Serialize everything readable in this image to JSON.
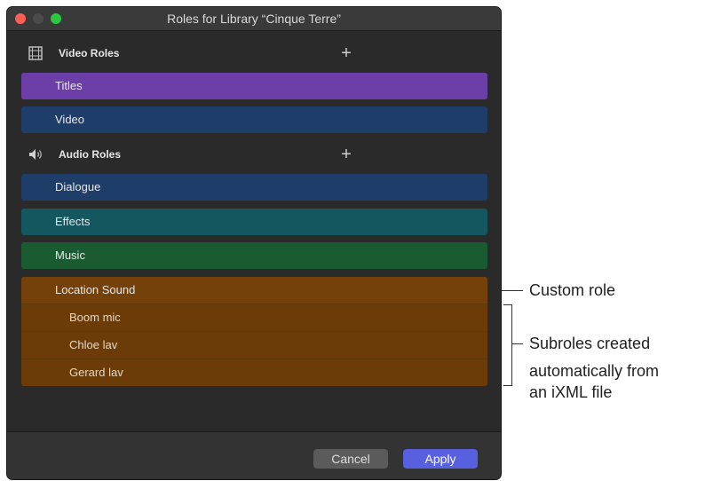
{
  "window": {
    "title": "Roles for Library “Cinque Terre”"
  },
  "video_section": {
    "label": "Video Roles",
    "add_symbol": "+",
    "icon": "film-icon"
  },
  "video_roles": [
    {
      "label": "Titles",
      "color": "#6c3fa8"
    },
    {
      "label": "Video",
      "color": "#1f3d69"
    }
  ],
  "audio_section": {
    "label": "Audio Roles",
    "add_symbol": "+",
    "icon": "speaker-icon"
  },
  "audio_roles": [
    {
      "label": "Dialogue",
      "color": "#1f3d69"
    },
    {
      "label": "Effects",
      "color": "#15575f"
    },
    {
      "label": "Music",
      "color": "#1a5b31"
    },
    {
      "label": "Location Sound",
      "color": "#74410a"
    }
  ],
  "subroles": [
    {
      "label": "Boom mic",
      "color": "#6b3c08"
    },
    {
      "label": "Chloe lav",
      "color": "#6b3c08"
    },
    {
      "label": "Gerard lav",
      "color": "#6b3c08"
    }
  ],
  "footer": {
    "cancel_label": "Cancel",
    "apply_label": "Apply"
  },
  "callouts": {
    "custom_role": "Custom role",
    "subroles_line1": "Subroles created",
    "subroles_line2": "automatically from",
    "subroles_line3": "an iXML file"
  }
}
